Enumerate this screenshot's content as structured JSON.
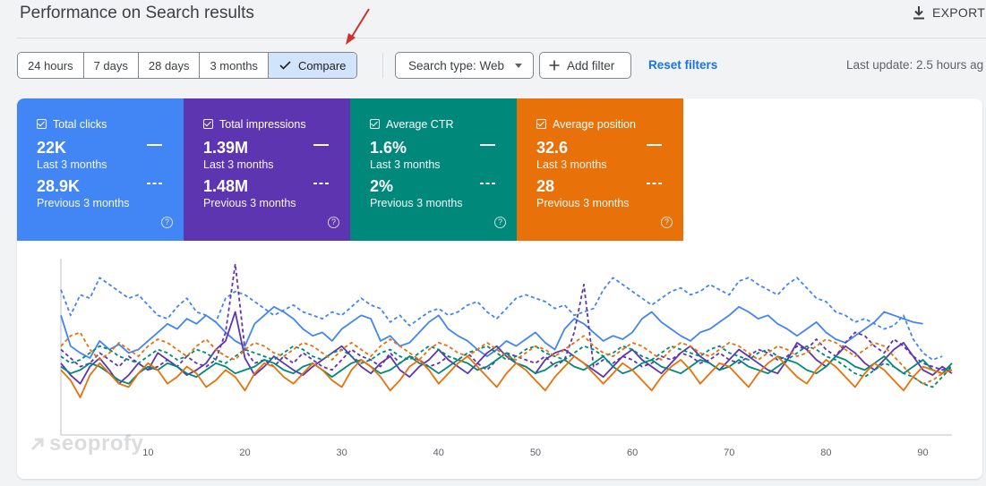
{
  "header": {
    "title": "Performance on Search results",
    "export_label": "EXPORT"
  },
  "toolbar": {
    "ranges": [
      "24 hours",
      "7 days",
      "28 days",
      "3 months"
    ],
    "compare_label": "Compare",
    "search_type": "Search type: Web",
    "add_filter": "Add filter",
    "reset": "Reset filters",
    "last_update": "Last update: 2.5 hours ag"
  },
  "metrics": [
    {
      "label": "Total clicks",
      "current": "22K",
      "current_period": "Last 3 months",
      "previous": "28.9K",
      "previous_period": "Previous 3 months",
      "color": "#4285f4"
    },
    {
      "label": "Total impressions",
      "current": "1.39M",
      "current_period": "Last 3 months",
      "previous": "1.48M",
      "previous_period": "Previous 3 months",
      "color": "#5e35b1"
    },
    {
      "label": "Average CTR",
      "current": "1.6%",
      "current_period": "Last 3 months",
      "previous": "2%",
      "previous_period": "Previous 3 months",
      "color": "#00897b"
    },
    {
      "label": "Average position",
      "current": "32.6",
      "current_period": "Last 3 months",
      "previous": "28",
      "previous_period": "Previous 3 months",
      "color": "#e8710a"
    }
  ],
  "chart_data": {
    "type": "line",
    "xlim": [
      1,
      93
    ],
    "x_ticks": [
      10,
      20,
      30,
      40,
      50,
      60,
      70,
      80,
      90
    ],
    "grid": false,
    "legend": "none",
    "series": [
      {
        "color": "#4285f4",
        "dash": false,
        "values": [
          0.7,
          0.52,
          0.48,
          0.45,
          0.55,
          0.5,
          0.53,
          0.48,
          0.5,
          0.55,
          0.6,
          0.65,
          0.62,
          0.68,
          0.65,
          0.7,
          0.66,
          0.6,
          0.55,
          0.52,
          0.65,
          0.7,
          0.75,
          0.72,
          0.68,
          0.62,
          0.58,
          0.6,
          0.55,
          0.62,
          0.66,
          0.7,
          0.68,
          0.55,
          0.58,
          0.52,
          0.54,
          0.6,
          0.66,
          0.7,
          0.62,
          0.58,
          0.55,
          0.5,
          0.46,
          0.5,
          0.55,
          0.52,
          0.56,
          0.6,
          0.54,
          0.5,
          0.62,
          0.68,
          0.65,
          0.6,
          0.55,
          0.58,
          0.56,
          0.6,
          0.68,
          0.72,
          0.66,
          0.62,
          0.58,
          0.55,
          0.6,
          0.62,
          0.66,
          0.7,
          0.75,
          0.72,
          0.68,
          0.7,
          0.65,
          0.62,
          0.58,
          0.62,
          0.66,
          0.6,
          0.56,
          0.54,
          0.58,
          0.62,
          0.66,
          0.72,
          0.7,
          0.68,
          0.66,
          0.65,
          null,
          null,
          null
        ]
      },
      {
        "color": "#4285f4",
        "dash": true,
        "values": [
          0.85,
          0.7,
          0.82,
          0.8,
          0.92,
          0.88,
          0.84,
          0.8,
          0.82,
          0.76,
          0.7,
          0.68,
          0.75,
          0.8,
          0.72,
          0.7,
          0.66,
          0.8,
          0.84,
          0.82,
          0.78,
          0.74,
          0.7,
          0.73,
          0.76,
          0.72,
          0.7,
          0.68,
          0.72,
          0.7,
          0.75,
          0.8,
          0.76,
          0.74,
          0.66,
          0.7,
          0.64,
          0.68,
          0.72,
          0.74,
          0.7,
          0.72,
          0.76,
          0.78,
          0.72,
          0.68,
          0.74,
          0.8,
          0.82,
          0.8,
          0.78,
          0.74,
          0.76,
          0.7,
          0.72,
          0.74,
          0.85,
          0.92,
          0.88,
          0.84,
          0.8,
          0.76,
          0.8,
          0.84,
          0.86,
          0.82,
          0.84,
          0.88,
          0.85,
          0.82,
          0.9,
          0.92,
          0.88,
          0.85,
          0.82,
          0.88,
          0.92,
          0.86,
          0.8,
          0.78,
          0.72,
          0.7,
          0.66,
          0.68,
          0.65,
          0.62,
          0.64,
          0.7,
          0.56,
          0.48,
          0.44,
          0.46,
          null
        ]
      },
      {
        "color": "#5e35b1",
        "dash": false,
        "values": [
          0.42,
          0.35,
          0.3,
          0.4,
          0.45,
          0.38,
          0.3,
          0.35,
          0.42,
          0.38,
          0.48,
          0.44,
          0.4,
          0.35,
          0.38,
          0.42,
          0.5,
          0.55,
          0.72,
          0.45,
          0.35,
          0.4,
          0.46,
          0.42,
          0.38,
          0.35,
          0.4,
          0.44,
          0.48,
          0.52,
          0.46,
          0.4,
          0.36,
          0.42,
          0.46,
          0.38,
          0.34,
          0.4,
          0.44,
          0.5,
          0.44,
          0.4,
          0.36,
          0.42,
          0.48,
          0.52,
          0.46,
          0.42,
          0.4,
          0.36,
          0.44,
          0.48,
          0.5,
          0.46,
          0.42,
          0.38,
          0.34,
          0.4,
          0.46,
          0.5,
          0.44,
          0.4,
          0.36,
          0.42,
          0.48,
          0.52,
          0.46,
          0.42,
          0.38,
          0.44,
          0.5,
          0.46,
          0.42,
          0.38,
          0.36,
          0.44,
          0.54,
          0.5,
          0.44,
          0.4,
          0.46,
          0.52,
          0.48,
          0.42,
          0.38,
          0.44,
          0.5,
          0.54,
          0.46,
          0.38,
          0.35,
          0.4,
          0.36
        ]
      },
      {
        "color": "#5e35b1",
        "dash": true,
        "values": [
          0.5,
          0.45,
          0.4,
          0.42,
          0.48,
          0.44,
          0.4,
          0.46,
          0.42,
          0.38,
          0.4,
          0.44,
          0.4,
          0.46,
          0.42,
          0.4,
          0.44,
          0.6,
          1.0,
          0.5,
          0.42,
          0.44,
          0.4,
          0.46,
          0.42,
          0.48,
          0.44,
          0.4,
          0.38,
          0.44,
          0.5,
          0.46,
          0.44,
          0.4,
          0.48,
          0.42,
          0.46,
          0.44,
          0.4,
          0.42,
          0.46,
          0.44,
          0.48,
          0.42,
          0.38,
          0.44,
          0.48,
          0.46,
          0.44,
          0.42,
          0.46,
          0.4,
          0.44,
          0.6,
          0.88,
          0.4,
          0.44,
          0.42,
          0.46,
          0.44,
          0.4,
          0.42,
          0.46,
          0.44,
          0.48,
          0.46,
          0.42,
          0.44,
          0.48,
          0.44,
          0.42,
          0.46,
          0.5,
          0.48,
          0.44,
          0.46,
          0.52,
          0.5,
          0.56,
          0.5,
          0.46,
          0.54,
          0.6,
          0.58,
          0.52,
          0.48,
          0.56,
          0.52,
          0.46,
          0.42,
          0.4,
          0.38,
          0.4
        ]
      },
      {
        "color": "#00897b",
        "dash": false,
        "values": [
          0.4,
          0.36,
          0.38,
          0.42,
          0.4,
          0.36,
          0.32,
          0.3,
          0.36,
          0.4,
          0.38,
          0.42,
          0.4,
          0.36,
          0.34,
          0.38,
          0.42,
          0.4,
          0.36,
          0.38,
          0.4,
          0.44,
          0.42,
          0.38,
          0.36,
          0.4,
          0.42,
          0.38,
          0.34,
          0.38,
          0.42,
          0.44,
          0.4,
          0.36,
          0.38,
          0.42,
          0.46,
          0.42,
          0.4,
          0.36,
          0.4,
          0.44,
          0.42,
          0.38,
          0.4,
          0.44,
          0.48,
          0.42,
          0.4,
          0.36,
          0.38,
          0.42,
          0.44,
          0.4,
          0.38,
          0.42,
          0.46,
          0.4,
          0.36,
          0.38,
          0.42,
          0.44,
          0.4,
          0.38,
          0.36,
          0.4,
          0.44,
          0.42,
          0.38,
          0.4,
          0.44,
          0.4,
          0.38,
          0.36,
          0.4,
          0.44,
          0.42,
          0.38,
          0.36,
          0.4,
          0.46,
          0.44,
          0.4,
          0.38,
          0.42,
          0.46,
          0.4,
          0.36,
          0.4,
          0.44,
          0.38,
          0.36,
          0.42
        ]
      },
      {
        "color": "#00897b",
        "dash": true,
        "values": [
          0.46,
          0.42,
          0.44,
          0.48,
          0.52,
          0.5,
          0.46,
          0.44,
          0.42,
          0.46,
          0.5,
          0.48,
          0.44,
          0.46,
          0.5,
          0.48,
          0.44,
          0.42,
          0.46,
          0.5,
          0.48,
          0.46,
          0.44,
          0.48,
          0.52,
          0.5,
          0.46,
          0.44,
          0.48,
          0.5,
          0.46,
          0.42,
          0.44,
          0.48,
          0.5,
          0.46,
          0.44,
          0.48,
          0.52,
          0.5,
          0.46,
          0.44,
          0.48,
          0.5,
          0.52,
          0.48,
          0.44,
          0.46,
          0.5,
          0.52,
          0.48,
          0.46,
          0.44,
          0.48,
          0.52,
          0.5,
          0.46,
          0.48,
          0.52,
          0.5,
          0.46,
          0.44,
          0.48,
          0.52,
          0.5,
          0.48,
          0.46,
          0.5,
          0.52,
          0.48,
          0.46,
          0.44,
          0.48,
          0.5,
          0.46,
          0.44,
          0.48,
          0.52,
          0.5,
          0.46,
          0.44,
          0.4,
          0.36,
          0.34,
          0.38,
          0.42,
          0.4,
          0.36,
          0.34,
          0.3,
          0.28,
          0.34,
          0.4
        ]
      },
      {
        "color": "#e8710a",
        "dash": false,
        "values": [
          0.38,
          0.32,
          0.22,
          0.35,
          0.42,
          0.36,
          0.3,
          0.28,
          0.36,
          0.42,
          0.38,
          0.3,
          0.34,
          0.4,
          0.36,
          0.28,
          0.32,
          0.38,
          0.34,
          0.26,
          0.36,
          0.42,
          0.4,
          0.34,
          0.3,
          0.36,
          0.42,
          0.38,
          0.32,
          0.28,
          0.38,
          0.44,
          0.4,
          0.34,
          0.26,
          0.32,
          0.4,
          0.44,
          0.38,
          0.3,
          0.36,
          0.42,
          0.46,
          0.4,
          0.34,
          0.28,
          0.36,
          0.42,
          0.38,
          0.32,
          0.26,
          0.34,
          0.4,
          0.46,
          0.42,
          0.36,
          0.3,
          0.36,
          0.42,
          0.38,
          0.32,
          0.26,
          0.34,
          0.4,
          0.44,
          0.38,
          0.3,
          0.36,
          0.42,
          0.4,
          0.34,
          0.28,
          0.36,
          0.42,
          0.46,
          0.4,
          0.34,
          0.3,
          0.38,
          0.44,
          0.4,
          0.34,
          0.28,
          0.36,
          0.42,
          0.38,
          0.32,
          0.26,
          0.34,
          0.4,
          0.38,
          0.36,
          0.38
        ]
      },
      {
        "color": "#e8710a",
        "dash": true,
        "values": [
          0.52,
          0.58,
          0.6,
          0.5,
          0.44,
          0.48,
          0.54,
          0.5,
          0.46,
          0.52,
          0.56,
          0.54,
          0.5,
          0.46,
          0.52,
          0.56,
          0.5,
          0.46,
          0.44,
          0.5,
          0.54,
          0.52,
          0.48,
          0.46,
          0.5,
          0.54,
          0.52,
          0.48,
          0.44,
          0.5,
          0.54,
          0.5,
          0.46,
          0.52,
          0.56,
          0.52,
          0.48,
          0.44,
          0.5,
          0.54,
          0.52,
          0.48,
          0.46,
          0.5,
          0.54,
          0.5,
          0.46,
          0.44,
          0.48,
          0.52,
          0.5,
          0.46,
          0.5,
          0.54,
          0.58,
          0.52,
          0.48,
          0.46,
          0.5,
          0.54,
          0.52,
          0.48,
          0.44,
          0.5,
          0.54,
          0.52,
          0.48,
          0.46,
          0.5,
          0.54,
          0.52,
          0.48,
          0.44,
          0.48,
          0.52,
          0.5,
          0.46,
          0.48,
          0.52,
          0.56,
          0.54,
          0.5,
          0.46,
          0.5,
          0.54,
          0.52,
          0.46,
          0.4,
          0.34,
          0.3,
          0.32,
          0.36,
          0.38
        ]
      }
    ]
  },
  "watermark": "seoprofy"
}
